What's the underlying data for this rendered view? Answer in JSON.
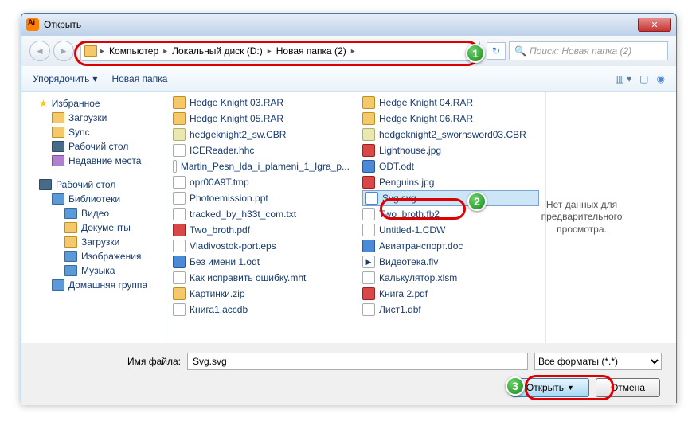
{
  "title": "Открыть",
  "breadcrumb": [
    "Компьютер",
    "Локальный диск (D:)",
    "Новая папка (2)"
  ],
  "search_placeholder": "Поиск: Новая папка (2)",
  "toolbar": {
    "organize": "Упорядочить",
    "new_folder": "Новая папка"
  },
  "sidebar": {
    "favorites": "Избранное",
    "downloads": "Загрузки",
    "sync": "Sync",
    "desktop": "Рабочий стол",
    "recent": "Недавние места",
    "libraries": "Библиотеки",
    "video": "Видео",
    "documents": "Документы",
    "pictures": "Изображения",
    "music": "Музыка",
    "homegroup": "Домашняя группа"
  },
  "files": {
    "col1": [
      "Hedge Knight 03.RAR",
      "Hedge Knight 05.RAR",
      "hedgeknight2_sw.CBR",
      "ICEReader.hhc",
      "Martin_Pesn_lda_i_plameni_1_Igra_p...",
      "opr00A9T.tmp",
      "Photoemission.ppt",
      "tracked_by_h33t_com.txt",
      "Two_broth.pdf",
      "Vladivostok-port.eps",
      "Без имени 1.odt",
      "Как исправить ошибку.mht",
      "Картинки.zip",
      "Книга1.accdb"
    ],
    "col2": [
      "Hedge Knight 04.RAR",
      "Hedge Knight 06.RAR",
      "hedgeknight2_swornsword03.CBR",
      "Lighthouse.jpg",
      "ODT.odt",
      "Penguins.jpg",
      "Svg.svg",
      "Two_broth.fb2",
      "Untitled-1.CDW",
      "Авиатранспорт.doc",
      "Видеотека.flv",
      "Калькулятор.xlsm",
      "Книга 2.pdf",
      "Лист1.dbf"
    ]
  },
  "preview_text": "Нет данных для предварительного просмотра.",
  "filename_label": "Имя файла:",
  "filename_value": "Svg.svg",
  "filetype": "Все форматы (*.*)",
  "buttons": {
    "open": "Открыть",
    "cancel": "Отмена"
  },
  "markers": [
    "1",
    "2",
    "3"
  ]
}
